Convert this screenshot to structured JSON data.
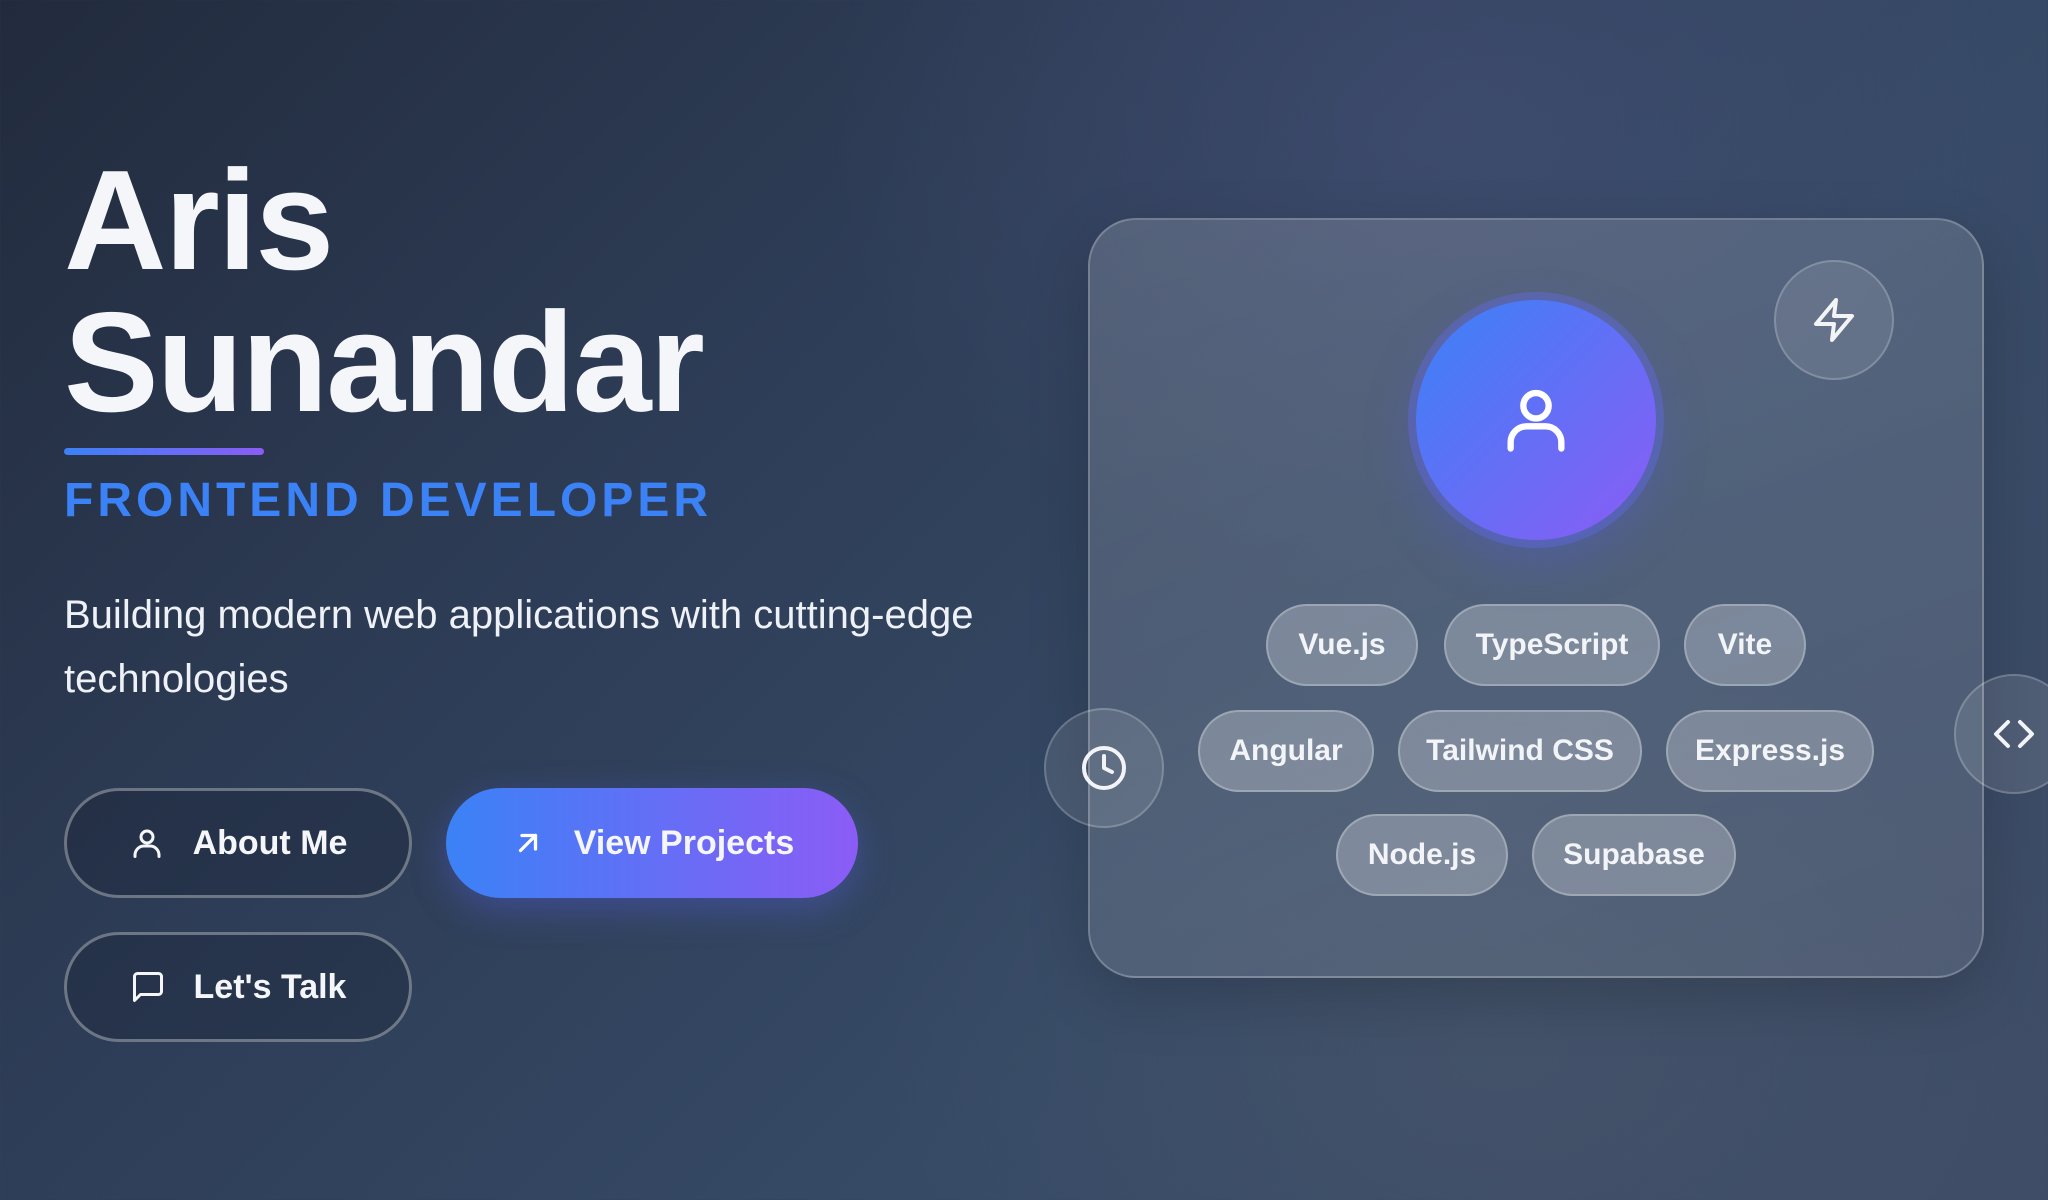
{
  "hero": {
    "name_line1": "Aris",
    "name_line2": "Sunandar",
    "role": "FRONTEND DEVELOPER",
    "tagline": "Building modern web applications with cutting-edge technologies"
  },
  "buttons": {
    "about": {
      "label": "About Me",
      "icon": "user-icon"
    },
    "projects": {
      "label": "View Projects",
      "icon": "arrow-up-right-icon"
    },
    "talk": {
      "label": "Let's Talk",
      "icon": "message-square-icon"
    }
  },
  "profile_card": {
    "avatar_icon": "user-icon",
    "floating_icons": [
      "zap-icon",
      "clock-icon",
      "code-icon"
    ],
    "tags": [
      "Vue.js",
      "TypeScript",
      "Vite",
      "Angular",
      "Tailwind CSS",
      "Express.js",
      "Node.js",
      "Supabase"
    ]
  },
  "colors": {
    "accent_blue": "#3b82f6",
    "accent_purple": "#8b5cf6",
    "background_dark": "#222b3d"
  }
}
